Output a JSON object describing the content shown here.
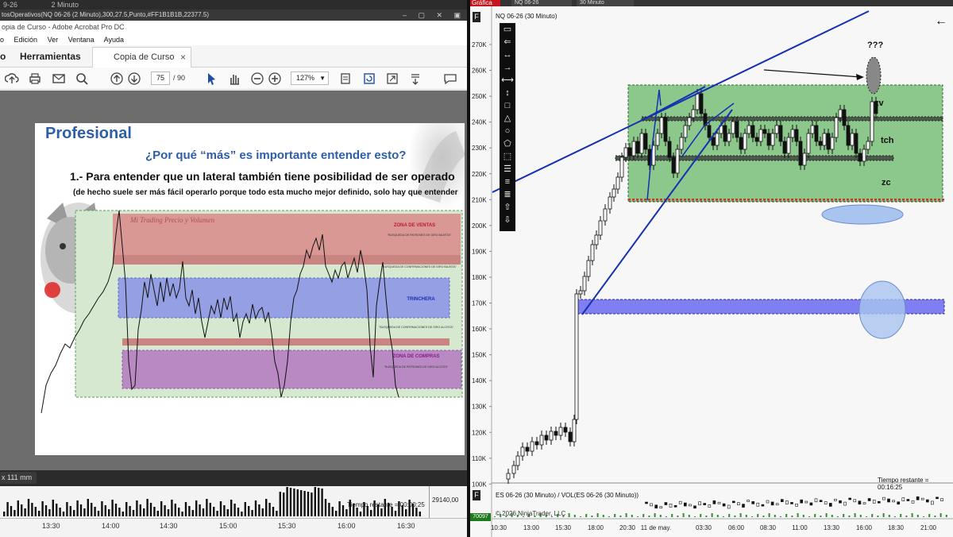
{
  "left_window": {
    "ninja_strip_text": "9-26",
    "ninja_strip_sub": "2 Minuto",
    "ninja_title": "tosOperativos(NQ 06-26 (2 Minuto),300,27.5,Punto,#FF1B1B1B,22377.5)",
    "acrobat_title": "opia de Curso - Adobe Acrobat Pro DC",
    "menu": [
      "o",
      "Edición",
      "Ver",
      "Ventana",
      "Ayuda"
    ],
    "tabs": {
      "home": "o",
      "tools": "Herramientas",
      "document": "Copia de Curso",
      "close": "×"
    },
    "toolbar": {
      "page_current": "75",
      "page_total": "/  90",
      "zoom": "127%"
    },
    "slide": {
      "title": "Profesional",
      "question": "¿Por qué “más” es importante entender esto?",
      "point1": "1.- Para entender que un lateral también tiene posibilidad de ser operado",
      "point1_note": "(de hecho suele ser más fácil operarlo porque todo esta mucho mejor definido, solo hay que entender",
      "watermark": "Mi Trading Precio y Volumen",
      "zones": {
        "sell_zone": "ZONA DE VENTAS",
        "sell_note": "\"BUSQUEDA DE PATRONES DE GIRO BAJISTA\"",
        "sell_confirm": "\"BUSQUEDA DE CONFIRMACIONES DE GIRO BAJISTA\"",
        "trench": "TRINCHERA",
        "buy_confirm": "\"BUSQUEDA DE CONFIRMACIONES DE GIRO ALCISTA\"",
        "buy_zone": "ZONA DE COMPRAS",
        "buy_note": "\"BUSQUEDA DE PATRONES DE GIRO ALCISTA\""
      }
    },
    "dim_badge": "x 111 mm",
    "volume": {
      "remaining": "Tiempo restante = 00:00:25",
      "price": "29140,00"
    },
    "time_axis": [
      "13:30",
      "14:00",
      "14:30",
      "15:00",
      "15:30",
      "16:00",
      "16:30"
    ]
  },
  "right_window": {
    "tab": "Gráfica",
    "instrument": "NQ 06-26",
    "interval": "30 Minuto",
    "chart_title": "NQ 06-26 (30 Minuto)",
    "f_badge": "F",
    "price_axis": [
      "270K",
      "260K",
      "250K",
      "240K",
      "230K",
      "220K",
      "210K",
      "200K",
      "190K",
      "180K",
      "170K",
      "160K",
      "150K",
      "140K",
      "130K",
      "120K",
      "110K",
      "100K"
    ],
    "annotations": {
      "question": "???",
      "zv": "zv",
      "tch": "tch",
      "zc": "zc"
    },
    "remaining": "Tiempo restante = 00:16:25",
    "lower_panel_title": "ES 06-26 (30 Minuto) / VOL(ES 06-26 (30 Minuto))",
    "copyright": "© 2026 NinjaTrader, LLC",
    "volume_value": "70097",
    "time_axis": [
      "10:30",
      "13:00",
      "15:30",
      "18:00",
      "20:30",
      "11 de may.",
      "03:30",
      "06:00",
      "08:30",
      "11:00",
      "13:30",
      "16:00",
      "18:30",
      "21:00"
    ],
    "back_icon": "arrow-left-icon"
  },
  "colors": {
    "zone_green": "#7fc47f",
    "box_blue": "#6a6af0",
    "trendline": "#1530b0",
    "sell_red": "#d98a8a",
    "trench_blue": "#8f97e6",
    "buy_purple": "#b57fc2"
  }
}
